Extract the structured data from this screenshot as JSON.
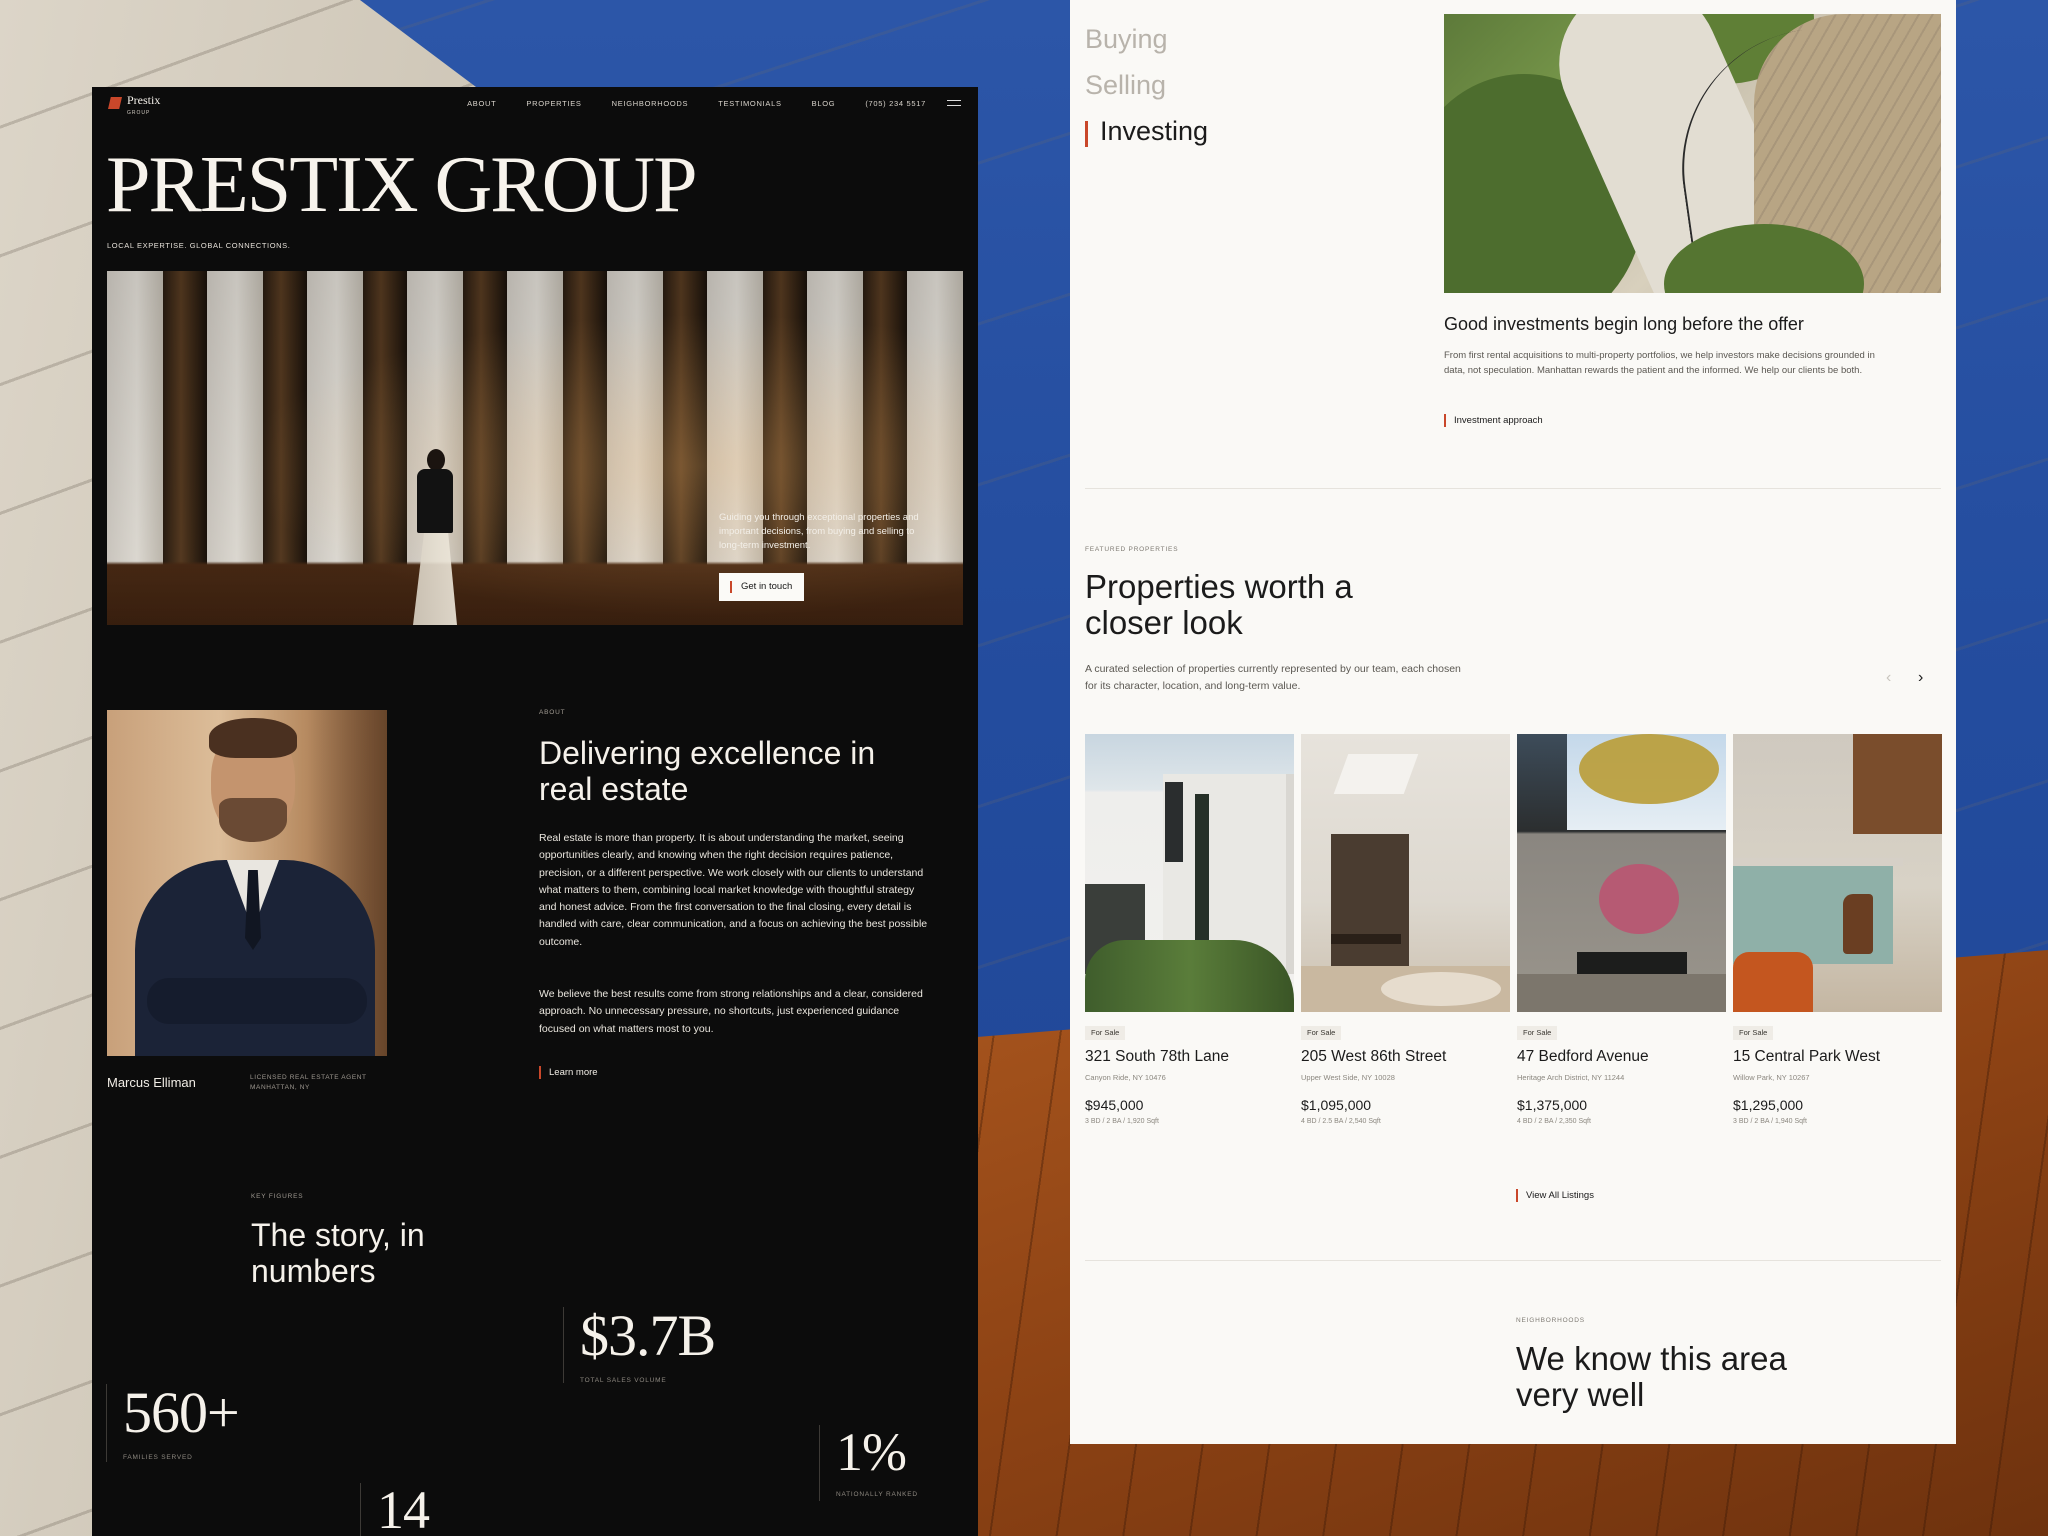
{
  "colors": {
    "accent": "#c9472a",
    "dark_bg": "#0c0c0c",
    "light_bg": "#faf9f6",
    "backdrop_blue": "#2a4f9c"
  },
  "left_page": {
    "logo": {
      "name": "Prestix",
      "sub": "GROUP"
    },
    "nav": [
      "ABOUT",
      "PROPERTIES",
      "NEIGHBORHOODS",
      "TESTIMONIALS",
      "BLOG",
      "(705) 234 5517"
    ],
    "menu_icon": "hamburger-icon",
    "hero": {
      "title": "PRESTIX GROUP",
      "tagline": "LOCAL EXPERTISE. GLOBAL CONNECTIONS.",
      "copy": "Guiding you through exceptional properties and important decisions, from buying and selling to long-term investment.",
      "cta": "Get in touch"
    },
    "agent": {
      "name": "Marcus Elliman",
      "role": "LICENSED REAL ESTATE AGENT",
      "location": "MANHATTAN, NY"
    },
    "about": {
      "label": "ABOUT",
      "title": "Delivering excellence in real estate",
      "p1": "Real estate is more than property. It is about understanding the market, seeing opportunities clearly, and knowing when the right decision requires patience, precision, or a different perspective. We work closely with our clients to understand what matters to them, combining local market knowledge with thoughtful strategy and honest advice. From the first conversation to the final closing, every detail is handled with care, clear communication, and a focus on achieving the best possible outcome.",
      "p2": "We believe the best results come from strong relationships and a clear, considered approach. No unnecessary pressure, no shortcuts, just experienced guidance focused on what matters most to you.",
      "link": "Learn more"
    },
    "key_figures": {
      "label": "KEY FIGURES",
      "title": "The story, in numbers",
      "stats": [
        {
          "value": "$3.7B",
          "label": "TOTAL SALES VOLUME"
        },
        {
          "value": "560+",
          "label": "FAMILIES SERVED"
        },
        {
          "value": "1%",
          "label": "NATIONALLY RANKED"
        },
        {
          "value": "14",
          "label": ""
        }
      ]
    }
  },
  "right_page": {
    "services": [
      "Buying",
      "Selling",
      "Investing"
    ],
    "investing": {
      "title": "Good investments begin long before the offer",
      "copy": "From first rental acquisitions to multi-property portfolios, we help investors make decisions grounded in data, not speculation. Manhattan rewards the patient and the informed. We help our clients be both.",
      "link": "Investment approach"
    },
    "featured": {
      "label": "FEATURED PROPERTIES",
      "title": "Properties worth a closer look",
      "copy": "A curated selection of properties currently represented by our team, each chosen for its character, location, and long-term value.",
      "prev_icon": "‹",
      "next_icon": "›",
      "cards": [
        {
          "badge": "For Sale",
          "title": "321 South 78th Lane",
          "location": "Canyon Ride, NY 10476",
          "price": "$945,000",
          "specs": "3 BD  /  2 BA  /  1,920 Sqft"
        },
        {
          "badge": "For Sale",
          "title": "205 West 86th Street",
          "location": "Upper West Side, NY 10028",
          "price": "$1,095,000",
          "specs": "4 BD  /  2.5 BA  /  2,540 Sqft"
        },
        {
          "badge": "For Sale",
          "title": "47 Bedford Avenue",
          "location": "Heritage Arch District, NY 11244",
          "price": "$1,375,000",
          "specs": "4 BD  /  2 BA  /  2,350 Sqft"
        },
        {
          "badge": "For Sale",
          "title": "15 Central Park West",
          "location": "Willow Park, NY 10267",
          "price": "$1,295,000",
          "specs": "3 BD  /  2 BA  /  1,940 Sqft"
        }
      ],
      "view_all": "View All Listings"
    },
    "neighborhoods": {
      "label": "NEIGHBORHOODS",
      "title": "We know this area very well"
    }
  }
}
